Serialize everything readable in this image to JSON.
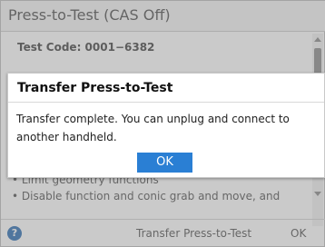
{
  "background_dialog": {
    "title": "Press-to-Test (CAS Off)",
    "test_code": "Test Code: 0001−6382",
    "bullets": [
      "• Limit geometry functions",
      "• Disable function and conic grab and move, and"
    ],
    "footer": {
      "help_icon": "?",
      "transfer_label": "Transfer Press-to-Test",
      "ok_label": "OK"
    }
  },
  "modal": {
    "title": "Transfer Press-to-Test",
    "message": "Transfer complete. You can unplug and connect to another handheld.",
    "ok_label": "OK"
  },
  "colors": {
    "accent": "#2a7fd4",
    "help_icon": "#2e6fb4"
  }
}
